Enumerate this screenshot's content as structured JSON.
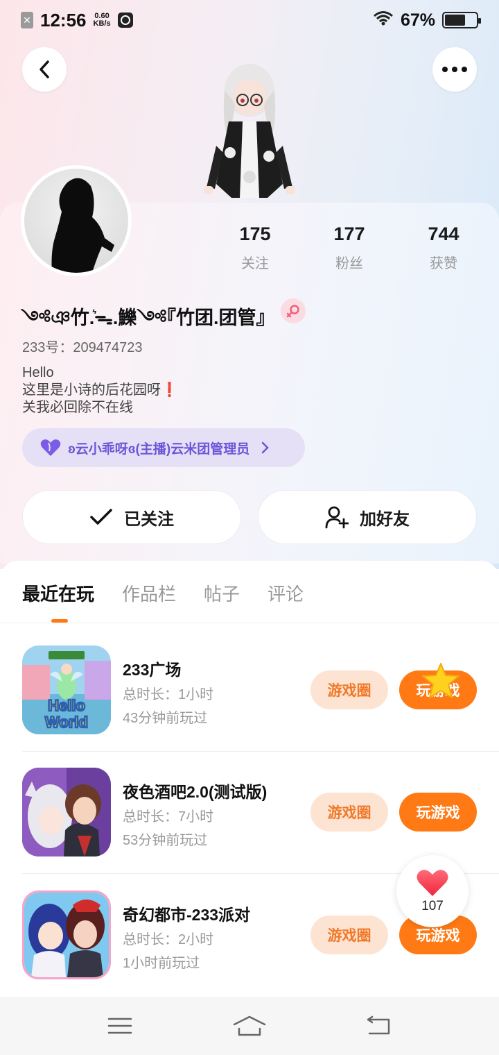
{
  "status_bar": {
    "time": "12:56",
    "net_speed_value": "0.60",
    "net_speed_unit": "KB/s",
    "battery_text": "67%",
    "battery_level": 0.67
  },
  "profile": {
    "stats": [
      {
        "value": "175",
        "label": "关注"
      },
      {
        "value": "177",
        "label": "粉丝"
      },
      {
        "value": "744",
        "label": "获赞"
      }
    ],
    "nickname": "༺ঞ竹.͛ᯓ.鱳༺『竹团.团管』",
    "uid": "233号：209474723",
    "bio": {
      "line1": "Hello",
      "line2": "这里是小诗的后花园呀",
      "line2_emoji": "❗",
      "line3": "关我必回除不在线"
    },
    "tag": "ʚ云小乖呀ɞ(主播)云米团管理员"
  },
  "actions": {
    "follow_label": "已关注",
    "add_friend_label": "加好友"
  },
  "tabs": [
    {
      "label": "最近在玩",
      "active": true
    },
    {
      "label": "作品栏",
      "active": false
    },
    {
      "label": "帖子",
      "active": false
    },
    {
      "label": "评论",
      "active": false
    }
  ],
  "games": [
    {
      "title": "233广场",
      "duration": "总时长：1小时",
      "last_played": "43分钟前玩过",
      "icon_text": "Hello World",
      "circle_label": "游戏圈",
      "play_label": "玩游戏"
    },
    {
      "title": "夜色酒吧2.0(测试版)",
      "duration": "总时长：7小时",
      "last_played": "53分钟前玩过",
      "circle_label": "游戏圈",
      "play_label": "玩游戏"
    },
    {
      "title": "奇幻都市-233派对",
      "duration": "总时长：2小时",
      "last_played": "1小时前玩过",
      "circle_label": "游戏圈",
      "play_label": "玩游戏"
    }
  ],
  "like_float": {
    "count": "107"
  },
  "colors": {
    "accent": "#ff7a14",
    "accent_soft": "#fde3d2",
    "tag_bg": "#e6e0f6",
    "tag_text": "#6c55d8"
  }
}
